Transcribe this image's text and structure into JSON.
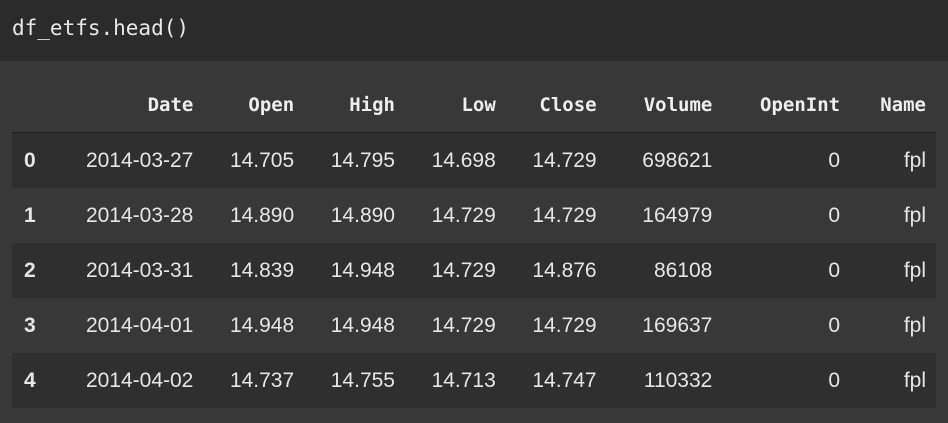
{
  "code_cell": {
    "source": "df_etfs.head()"
  },
  "dataframe": {
    "columns": [
      "",
      "Date",
      "Open",
      "High",
      "Low",
      "Close",
      "Volume",
      "OpenInt",
      "Name"
    ],
    "rows": [
      [
        "0",
        "2014-03-27",
        "14.705",
        "14.795",
        "14.698",
        "14.729",
        "698621",
        "0",
        "fpl"
      ],
      [
        "1",
        "2014-03-28",
        "14.890",
        "14.890",
        "14.729",
        "14.729",
        "164979",
        "0",
        "fpl"
      ],
      [
        "2",
        "2014-03-31",
        "14.839",
        "14.948",
        "14.729",
        "14.876",
        "86108",
        "0",
        "fpl"
      ],
      [
        "3",
        "2014-04-01",
        "14.948",
        "14.948",
        "14.729",
        "14.729",
        "169637",
        "0",
        "fpl"
      ],
      [
        "4",
        "2014-04-02",
        "14.737",
        "14.755",
        "14.713",
        "14.747",
        "110332",
        "0",
        "fpl"
      ]
    ]
  }
}
